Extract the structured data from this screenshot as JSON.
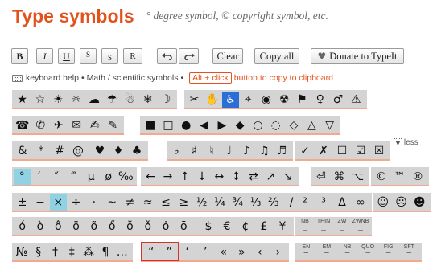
{
  "header": {
    "title": "Type symbols",
    "subtitle": "° degree symbol, © copyright symbol, etc."
  },
  "toolbar": {
    "bold": "B",
    "italic": "I",
    "underline": "U",
    "superscript": "S",
    "subscript": "S",
    "reset": "R",
    "clear": "Clear",
    "copy_all": "Copy all",
    "donate": "Donate to TypeIt",
    "donate_icon": "heart-icon",
    "undo_icon": "undo-icon",
    "redo_icon": "redo-icon"
  },
  "help": {
    "keyboard_help": "keyboard help",
    "sep1": "•",
    "math_symbols": "Math / scientific symbols",
    "sep2": "•",
    "shortcut": "Alt + click",
    "shortcut_hint": "button to copy to clipboard"
  },
  "less_toggle": "less",
  "colors": {
    "accent": "#e2521d",
    "selected": "#8fd2e4",
    "highlighted": "#2b6fd6",
    "group_bg": "#d4d4d4",
    "box_outline": "#d9312a"
  },
  "rows": [
    [
      [
        "★",
        "☆",
        "☀",
        "☼",
        "☁",
        "☂",
        "☃",
        "❄",
        "☽"
      ],
      [
        "✂",
        "✋",
        "♿",
        "⌖",
        "◉",
        "☢",
        "⚑",
        "♀",
        "♂",
        "⚠"
      ]
    ],
    [
      [
        "☎",
        "✆",
        "✈",
        "✉",
        "✍",
        "✎"
      ],
      [
        "■",
        "□",
        "●",
        "◀",
        "▶",
        "◆",
        "○",
        "◌",
        "◇",
        "△",
        "▽"
      ]
    ],
    [
      [
        "&",
        "*",
        "#",
        "@"
      ],
      [
        "♥",
        "♦",
        "♣"
      ],
      [
        "♭",
        "♯",
        "♮",
        "♩",
        "♪",
        "♫",
        "♬"
      ],
      [
        "✓",
        "✗",
        "☐",
        "☑",
        "☒"
      ]
    ],
    [
      [
        "°",
        "′",
        "″",
        "‴",
        "µ",
        "ø",
        "‰"
      ],
      [
        "←",
        "→",
        "↑",
        "↓",
        "↔",
        "↕",
        "⇄",
        "↗",
        "↘"
      ],
      [
        "⏎",
        "⌘",
        "⌥"
      ],
      [
        "©",
        "™",
        "®"
      ]
    ],
    [
      [
        "±",
        "−",
        "×",
        "÷",
        "·",
        "~",
        "≠",
        "≈",
        "≤",
        "≥",
        "½",
        "¼",
        "¾",
        "⅓",
        "⅔",
        "/"
      ],
      [
        "²",
        "³",
        "Δ",
        "∞"
      ],
      [
        "☺",
        "☹",
        "☻"
      ]
    ],
    [
      [
        "ó",
        "ò",
        "ô",
        "ö",
        "õ",
        "ő",
        "ŏ",
        "ǒ",
        "ȯ",
        "ō",
        "ọ"
      ],
      [
        "$",
        "€",
        "¢",
        "£",
        "¥"
      ],
      [
        "NB",
        "THIN",
        "ZW",
        "ZWNB"
      ]
    ],
    [
      [
        "№",
        "§",
        "†",
        "‡",
        "⁂",
        "¶",
        "…"
      ],
      [
        "“",
        "”",
        "‘",
        "’",
        "«",
        "»",
        "‹",
        "›"
      ],
      [
        "EN",
        "EM",
        "NB",
        "QUO",
        "FIG",
        "SFT"
      ]
    ]
  ]
}
